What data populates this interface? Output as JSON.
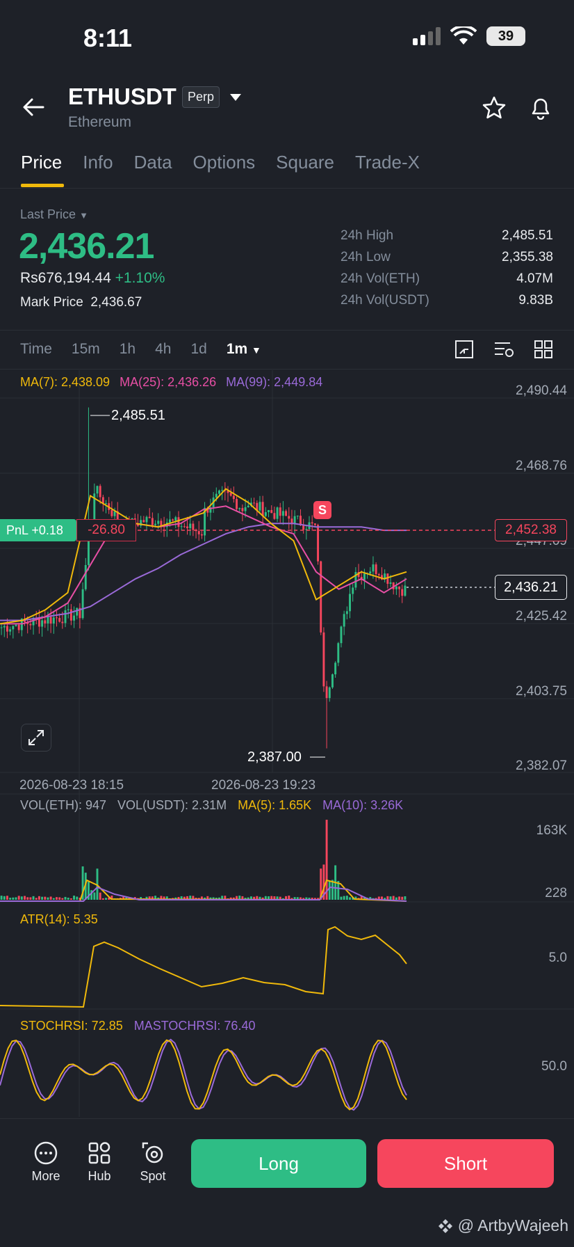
{
  "status": {
    "time": "8:11",
    "battery": "39"
  },
  "header": {
    "symbol": "ETHUSDT",
    "tag": "Perp",
    "name": "Ethereum"
  },
  "tabs": [
    "Price",
    "Info",
    "Data",
    "Options",
    "Square",
    "Trade-X"
  ],
  "price": {
    "label": "Last Price",
    "last": "2,436.21",
    "inr": "Rs676,194.44",
    "change": "+1.10%",
    "mark_label": "Mark Price",
    "mark": "2,436.67"
  },
  "stats": [
    {
      "k": "24h High",
      "v": "2,485.51"
    },
    {
      "k": "24h Low",
      "v": "2,355.38"
    },
    {
      "k": "24h Vol(ETH)",
      "v": "4.07M"
    },
    {
      "k": "24h Vol(USDT)",
      "v": "9.83B"
    }
  ],
  "intervals": [
    "Time",
    "15m",
    "1h",
    "4h",
    "1d",
    "1m"
  ],
  "ma": {
    "ma7": "MA(7): 2,438.09",
    "ma25": "MA(25): 2,436.26",
    "ma99": "MA(99): 2,449.84"
  },
  "colors": {
    "up": "#2ebd85",
    "down": "#f6465d",
    "ma7": "#f0b90b",
    "ma25": "#e84fa5",
    "ma99": "#9a6ad8"
  },
  "price_axis": [
    "2,490.44",
    "2,468.76",
    "2,447.09",
    "2,425.42",
    "2,403.75",
    "2,382.07"
  ],
  "overlay": {
    "pnl_label": "PnL +0.18",
    "pnl_value": "-26.80",
    "entry": "2,452.38",
    "last_tag": "2,436.21",
    "high_label": "2,485.51",
    "low_label": "2,387.00",
    "marker": "S"
  },
  "dates": [
    "2026-08-23 18:15",
    "2026-08-23 19:23"
  ],
  "volume": {
    "eth": "VOL(ETH): 947",
    "usdt": "VOL(USDT): 2.31M",
    "ma5": "MA(5): 1.65K",
    "ma10": "MA(10): 3.26K",
    "axis_top": "163K",
    "axis_bottom": "228"
  },
  "atr": {
    "label": "ATR(14): 5.35",
    "axis": "5.0"
  },
  "stoch": {
    "k": "STOCHRSI: 72.85",
    "d": "MASTOCHRSI: 76.40",
    "axis": "50.0"
  },
  "nav": [
    {
      "label": "More",
      "icon": "more-circle-icon"
    },
    {
      "label": "Hub",
      "icon": "grid-hub-icon"
    },
    {
      "label": "Spot",
      "icon": "spot-icon"
    }
  ],
  "actions": {
    "long": "Long",
    "short": "Short"
  },
  "watermark": "@ ArtbyWajeeh",
  "chart_data": {
    "type": "candlestick",
    "interval": "1m",
    "ylim": [
      2382.07,
      2490.44
    ],
    "ma7_approx": [
      2423,
      2424,
      2427,
      2432,
      2460,
      2456,
      2452,
      2451,
      2453,
      2455,
      2462,
      2458,
      2452,
      2447,
      2430,
      2434,
      2438,
      2436,
      2438
    ],
    "ma25_approx": [
      2423,
      2423,
      2425,
      2429,
      2440,
      2451,
      2452,
      2451,
      2452,
      2456,
      2457,
      2454,
      2451,
      2449,
      2438,
      2433,
      2436,
      2432,
      2436
    ],
    "ma99_approx": [
      2424,
      2424,
      2425,
      2426,
      2428,
      2432,
      2436,
      2439,
      2443,
      2446,
      2449,
      2451,
      2452,
      2452,
      2451,
      2451,
      2451,
      2450,
      2450
    ]
  }
}
